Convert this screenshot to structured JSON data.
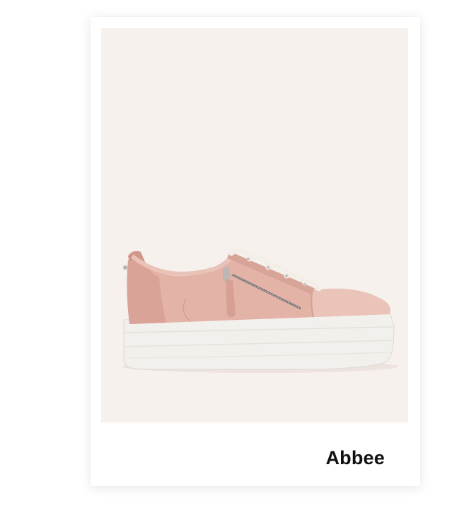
{
  "product": {
    "name": "Abbee",
    "image": "pink-platform-sneaker",
    "colors": {
      "background": "#f7f1ed",
      "upper": "#e6b5aa",
      "sole": "#f1efea",
      "lace": "#f4f0ea"
    }
  }
}
